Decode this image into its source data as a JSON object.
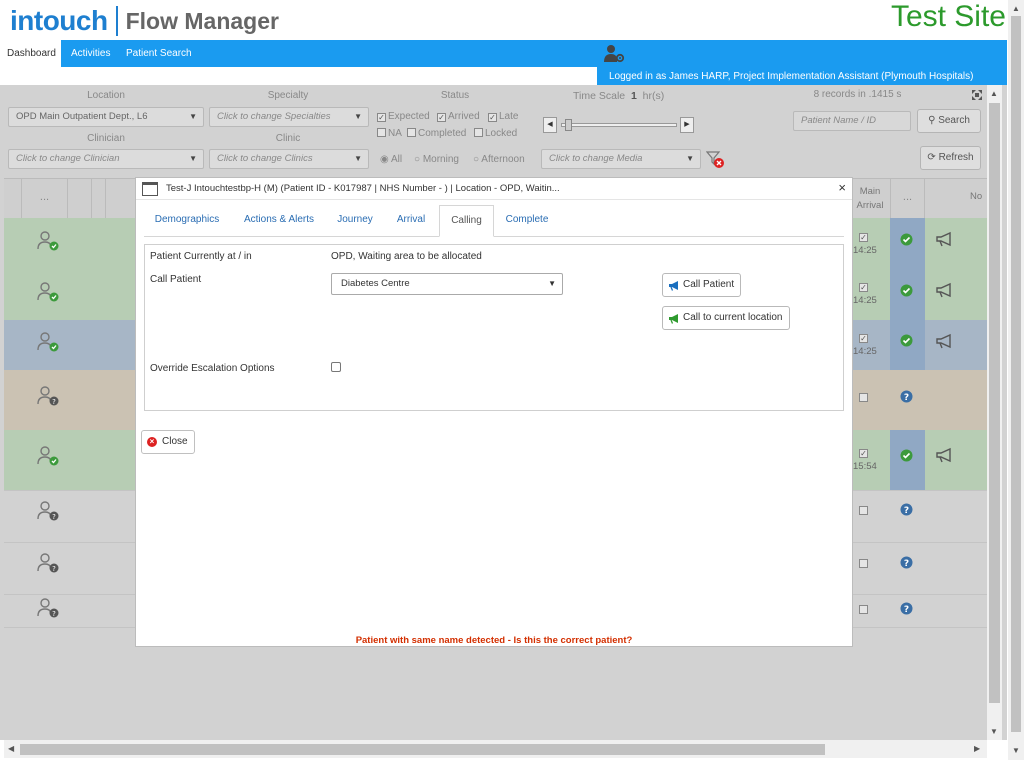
{
  "header": {
    "brand": "intouch",
    "product": "Flow Manager",
    "site_label": "Test Site",
    "login_text": "Logged in as James HARP, Project Implementation Assistant (Plymouth Hospitals)"
  },
  "nav": {
    "items": [
      {
        "label": "Dashboard",
        "active": true
      },
      {
        "label": "Activities",
        "active": false
      },
      {
        "label": "Patient Search",
        "active": false
      }
    ]
  },
  "filters": {
    "location_label": "Location",
    "location_value": "OPD Main Outpatient Dept., L6",
    "specialty_label": "Specialty",
    "specialty_placeholder": "Click to change Specialties",
    "clinician_label": "Clinician",
    "clinician_placeholder": "Click to change Clinician",
    "clinic_label": "Clinic",
    "clinic_placeholder": "Click to change Clinics",
    "status_label": "Status",
    "status_options": {
      "expected": "Expected",
      "arrived": "Arrived",
      "late": "Late",
      "na": "NA",
      "completed": "Completed",
      "locked": "Locked"
    },
    "time_options": {
      "all": "All",
      "morning": "Morning",
      "afternoon": "Afternoon"
    },
    "time_scale_label": "Time Scale",
    "time_scale_value": "1",
    "time_scale_unit": "hr(s)",
    "media_placeholder": "Click to change Media",
    "records_text": "8 records in .1415 s",
    "patient_search_placeholder": "Patient Name / ID",
    "search_label": "Search",
    "refresh_label": "Refresh"
  },
  "grid": {
    "header_dots": "...",
    "main_arrival_label": "Main Arrival",
    "no_label": "No",
    "times": [
      "14:25",
      "14:25",
      "14:25",
      "15:54"
    ]
  },
  "modal": {
    "title": "Test-J Intouchtestbp-H (M) (Patient ID - K017987 | NHS Number - ) | Location - OPD, Waitin...",
    "close_symbol": "×",
    "tabs": [
      {
        "label": "Demographics",
        "active": false
      },
      {
        "label": "Actions & Alerts",
        "active": false
      },
      {
        "label": "Journey",
        "active": false
      },
      {
        "label": "Arrival",
        "active": false
      },
      {
        "label": "Calling",
        "active": true
      },
      {
        "label": "Complete",
        "active": false
      }
    ],
    "patient_location_label": "Patient Currently at / in",
    "patient_location_value": "OPD, Waiting area to be allocated",
    "call_patient_label": "Call Patient",
    "call_patient_select_value": "Diabetes Centre",
    "call_patient_button": "Call Patient",
    "call_current_button": "Call to current location",
    "override_label": "Override Escalation Options",
    "close_button": "Close",
    "warning": "Patient with same name detected - Is this the correct patient?"
  },
  "colors": {
    "brand_blue": "#1e7fd0",
    "nav_blue": "#1a9bf0",
    "site_green": "#2c9a2c",
    "warning_red": "#d32f00"
  }
}
